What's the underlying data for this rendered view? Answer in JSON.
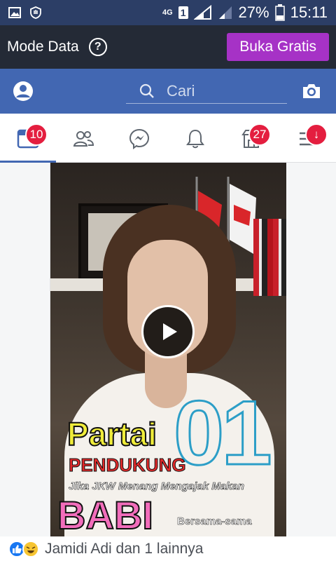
{
  "statusbar": {
    "network": "4G",
    "sim": "1",
    "battery": "27%",
    "time": "15:11",
    "icons": [
      "gallery-icon",
      "shield-hand-icon",
      "signal-icon",
      "battery-icon"
    ]
  },
  "modebar": {
    "title": "Mode Data",
    "help": "?",
    "buka_label": "Buka Gratis",
    "buka_color": "#a632c6"
  },
  "header": {
    "search_placeholder": "Cari",
    "bg_color": "#4267b2"
  },
  "tabs": [
    {
      "name": "home",
      "icon": "news-feed-icon",
      "badge": "10"
    },
    {
      "name": "friends",
      "icon": "friends-icon",
      "badge": ""
    },
    {
      "name": "messenger",
      "icon": "messenger-icon",
      "badge": ""
    },
    {
      "name": "notifications",
      "icon": "bell-icon",
      "badge": ""
    },
    {
      "name": "marketplace",
      "icon": "marketplace-icon",
      "badge": "27"
    },
    {
      "name": "menu",
      "icon": "menu-icon",
      "badge": "↓"
    }
  ],
  "video": {
    "overlay": {
      "partai": "Partai",
      "number": "01",
      "pendukung": "PENDUKUNG",
      "jika": "Jika JKW Menang Mengajak Makan",
      "babi": "BABI",
      "bersama": "Bersama-sama"
    }
  },
  "reactions": {
    "text": "Jamidi Adi dan 1 lainnya",
    "types": [
      "like",
      "haha"
    ]
  }
}
